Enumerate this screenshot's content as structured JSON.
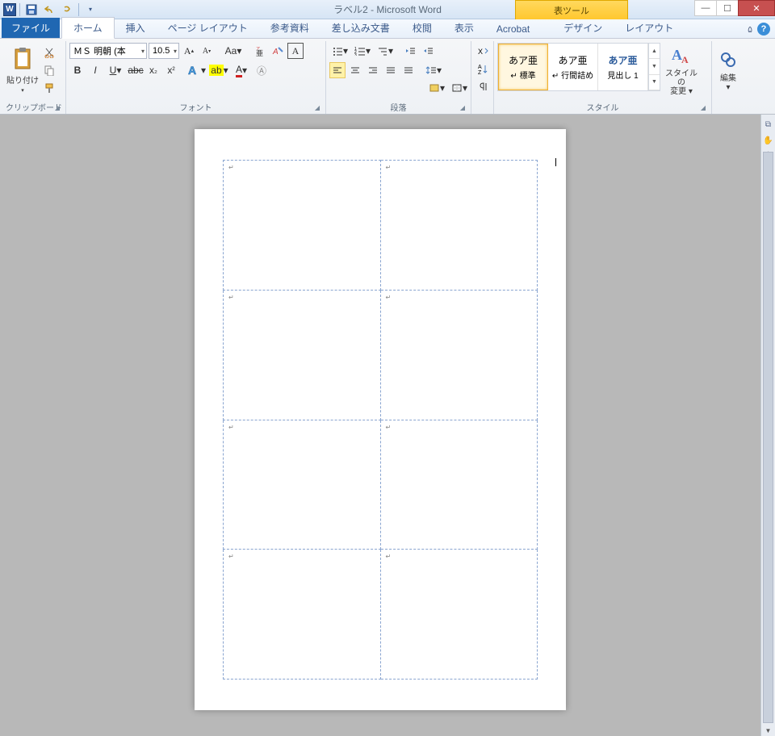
{
  "title": "ラベル2 - Microsoft Word",
  "context_tool": "表ツール",
  "tabs": {
    "file": "ファイル",
    "home": "ホーム",
    "insert": "挿入",
    "layout": "ページ レイアウト",
    "references": "参考資料",
    "mailings": "差し込み文書",
    "review": "校閲",
    "view": "表示",
    "acrobat": "Acrobat",
    "design": "デザイン",
    "table_layout": "レイアウト"
  },
  "clipboard": {
    "paste": "貼り付け",
    "group_label": "クリップボード"
  },
  "font": {
    "name": "ＭＳ 明朝 (本",
    "size": "10.5",
    "group_label": "フォント"
  },
  "paragraph": {
    "group_label": "段落"
  },
  "styles": {
    "group_label": "スタイル",
    "items": [
      {
        "preview": "あア亜",
        "name": "↵ 標準"
      },
      {
        "preview": "あア亜",
        "name": "↵ 行間詰め"
      },
      {
        "preview": "あア亜",
        "name": "見出し 1"
      }
    ],
    "change": "スタイルの\n変更 ▾"
  },
  "editing": {
    "label": "編集\n▾"
  },
  "word_letter": "W"
}
